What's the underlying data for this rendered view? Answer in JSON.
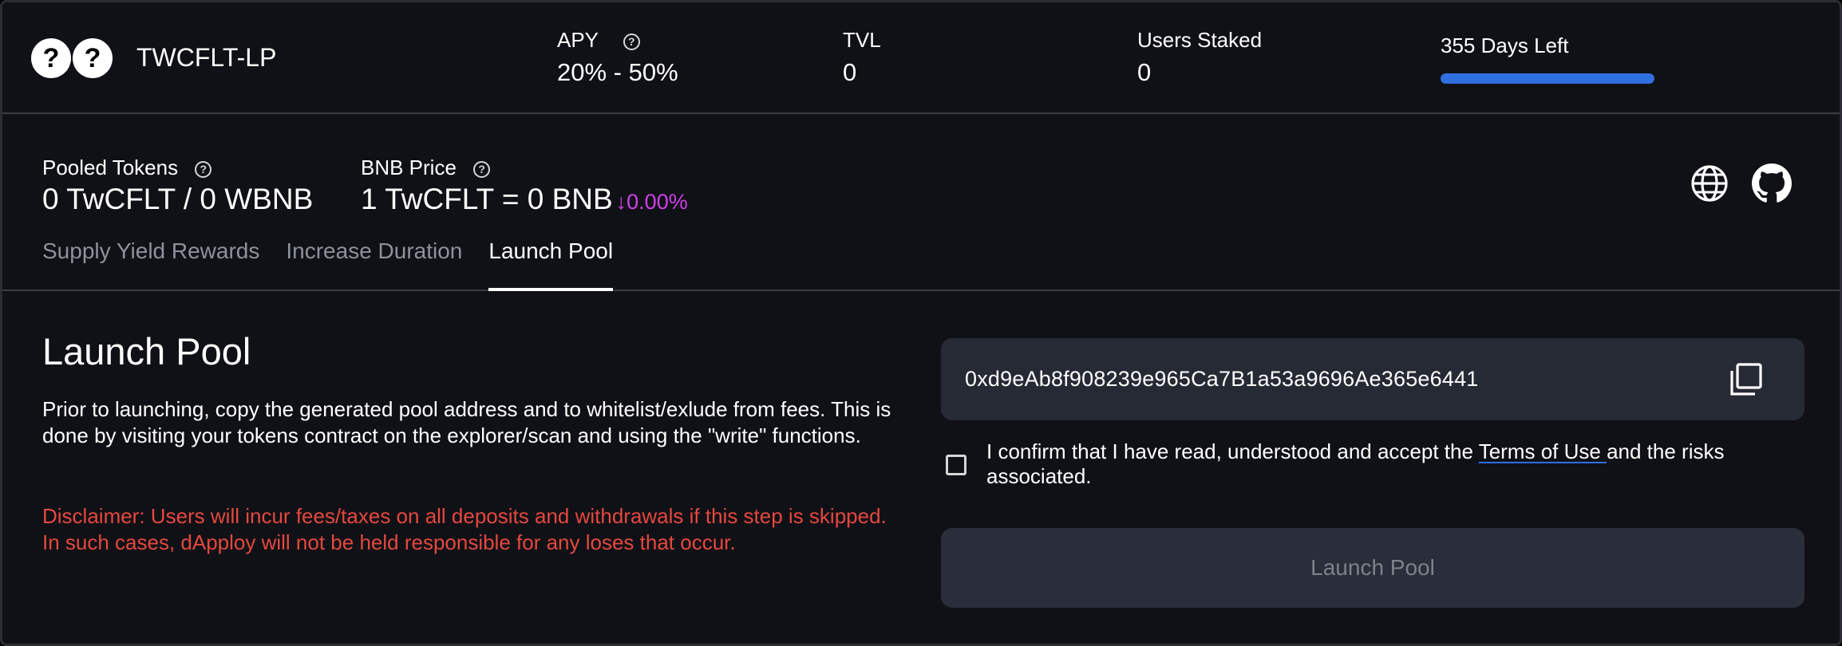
{
  "header": {
    "token_icons": [
      "?",
      "?"
    ],
    "pair_name": "TWCFLT-LP",
    "apy": {
      "label": "APY",
      "value": "20% - 50%"
    },
    "tvl": {
      "label": "TVL",
      "value": "0"
    },
    "users_staked": {
      "label": "Users Staked",
      "value": "0"
    },
    "days_left": {
      "label": "355 Days Left",
      "progress_percent": 100,
      "bar_color": "#2f6fe0"
    }
  },
  "info": {
    "pooled_tokens": {
      "label": "Pooled Tokens",
      "value": "0 TwCFLT / 0 WBNB"
    },
    "bnb_price": {
      "label": "BNB Price",
      "value": "1 TwCFLT = 0 BNB",
      "change": "↓0.00%",
      "change_color": "#d040e8"
    },
    "links": [
      "globe-icon",
      "github-icon"
    ]
  },
  "tabs": [
    {
      "label": "Supply Yield Rewards",
      "active": false
    },
    {
      "label": "Increase Duration",
      "active": false
    },
    {
      "label": "Launch Pool",
      "active": true
    }
  ],
  "main": {
    "title": "Launch Pool",
    "description": "Prior to launching, copy the generated pool address and to whitelist/exlude from fees. This is done by visiting your tokens contract on the explorer/scan and using the \"write\" functions.",
    "disclaimer": "Disclaimer: Users will incur fees/taxes on all deposits and withdrawals if this step is skipped. In such cases, dApploy will not be held responsible for any loses that occur.",
    "pool_address": "0xd9eAb8f908239e965Ca7B1a53a9696Ae365e6441",
    "confirm_prefix": "I confirm that I have read, understood and accept the ",
    "terms_link": "Terms of Use ",
    "confirm_suffix": "and the risks associated.",
    "checkbox_checked": false,
    "launch_button": "Launch Pool"
  }
}
